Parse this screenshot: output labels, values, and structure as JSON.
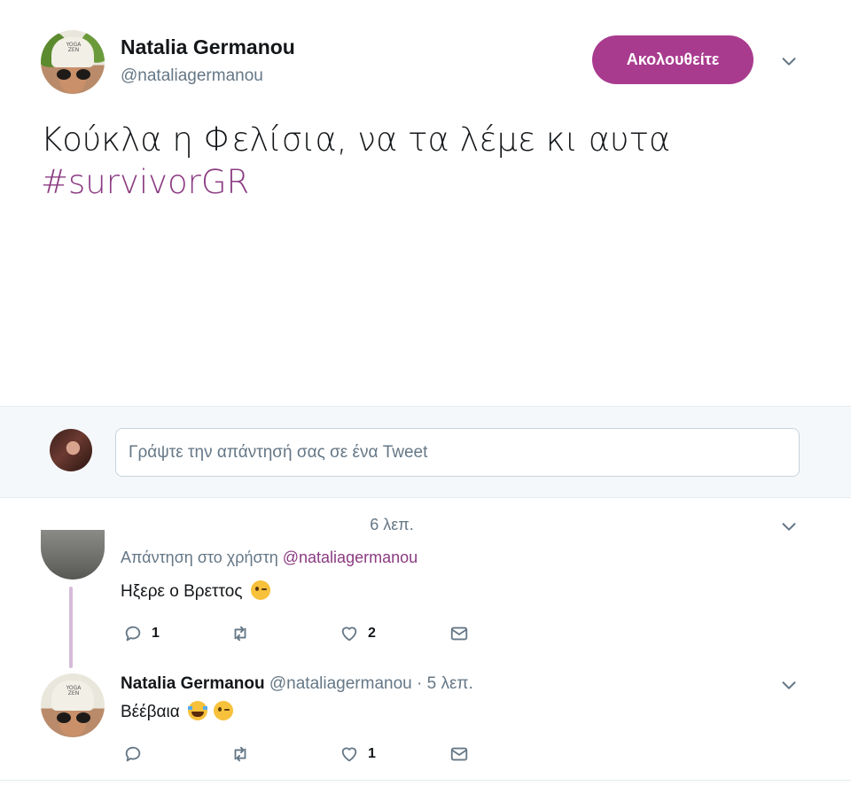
{
  "tweet": {
    "author_name": "Natalia Germanou",
    "author_handle": "@nataliagermanou",
    "follow_label": "Ακολουθείτε",
    "text": "Κούκλα η Φελίσια, να τα λέμε κι αυτα",
    "hashtag": "#survivorGR",
    "avatar_hat_text": "YOGA ZEN"
  },
  "composer": {
    "placeholder": "Γράψτε την απάντησή σας σε ένα Tweet"
  },
  "replies": [
    {
      "timestamp": "6 λεπ.",
      "replying_to_prefix": "Απάντηση στο χρήστη",
      "replying_to_handle": "@nataliagermanou",
      "text": "Ηξερε ο Βρεττος",
      "emojis": [
        "winking-face"
      ],
      "reply_count": "1",
      "retweet_count": "",
      "like_count": "2"
    },
    {
      "author_name": "Natalia Germanou",
      "author_meta": "@nataliagermanou · 5 λεπ.",
      "text": "Βέέβαια",
      "emojis": [
        "face-with-tears-of-joy",
        "winking-face"
      ],
      "reply_count": "",
      "retweet_count": "",
      "like_count": "1"
    }
  ],
  "colors": {
    "accent": "#a93b8f",
    "hashtag": "#8b3b82",
    "muted": "#657786",
    "thread_line": "#d6bcd9"
  }
}
